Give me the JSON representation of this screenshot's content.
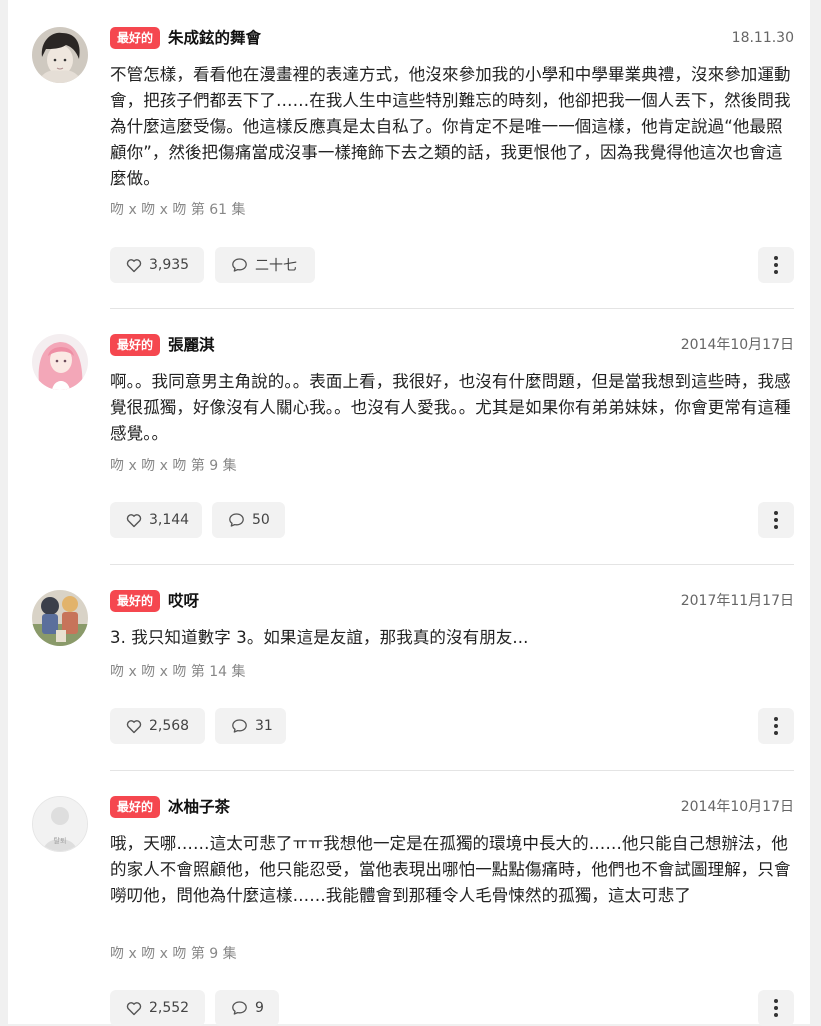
{
  "comments": [
    {
      "badge": "最好的",
      "author": "朱成鉉的舞會",
      "date": "18.11.30",
      "text": "不管怎樣，看看他在漫畫裡的表達方式，他沒來參加我的小學和中學畢業典禮，沒來參加運動會，把孩子們都丟下了……在我人生中這些特別難忘的時刻，他卻把我一個人丟下，然後問我為什麼這麼受傷。他這樣反應真是太自私了。你肯定不是唯一一個這樣，他肯定說過“他最照顧你”，然後把傷痛當成沒事一樣掩飾下去之類的話，我更恨他了，因為我覺得他這次也會這麼做。",
      "episode": "吻 x 吻 x 吻 第 61 集",
      "likes": "3,935",
      "replies": "二十七",
      "avatar_icon": "dark-haired-boy-avatar"
    },
    {
      "badge": "最好的",
      "author": "張麗淇",
      "date": "2014年10月17日",
      "text": "啊。。我同意男主角說的。。表面上看，我很好，也沒有什麼問題，但是當我想到這些時，我感覺很孤獨，好像沒有人關心我。。也沒有人愛我。。尤其是如果你有弟弟妹妹，你會更常有這種感覺。。",
      "episode": "吻 x 吻 x 吻 第 9 集",
      "likes": "3,144",
      "replies": "50",
      "avatar_icon": "pink-haired-girl-avatar"
    },
    {
      "badge": "最好的",
      "author": "哎呀",
      "date": "2017年11月17日",
      "text": "3. 我只知道數字 3。如果這是友誼，那我真的沒有朋友...",
      "episode": "吻 x 吻 x 吻 第 14 集",
      "likes": "2,568",
      "replies": "31",
      "avatar_icon": "cartoon-character-avatar"
    },
    {
      "badge": "最好的",
      "author": "冰柚子茶",
      "date": "2014年10月17日",
      "text": "哦，天哪……這太可悲了ㅠㅠ我想他一定是在孤獨的環境中長大的……他只能自己想辦法，他的家人不會照顧他，他只能忍受，當他表現出哪怕一點點傷痛時，他們也不會試圖理解，只會嘮叨他，問他為什麼這樣……我能體會到那種令人毛骨悚然的孤獨，這太可悲了",
      "episode": "吻 x 吻 x 吻 第 9 集",
      "likes": "2,552",
      "replies": "9",
      "avatar_icon": "default-user-avatar",
      "avatar_label": "탈퇴"
    }
  ],
  "colors": {
    "badge": "#f5474f",
    "pill_bg": "#f2f2f2",
    "divider": "#e4e4e4"
  }
}
